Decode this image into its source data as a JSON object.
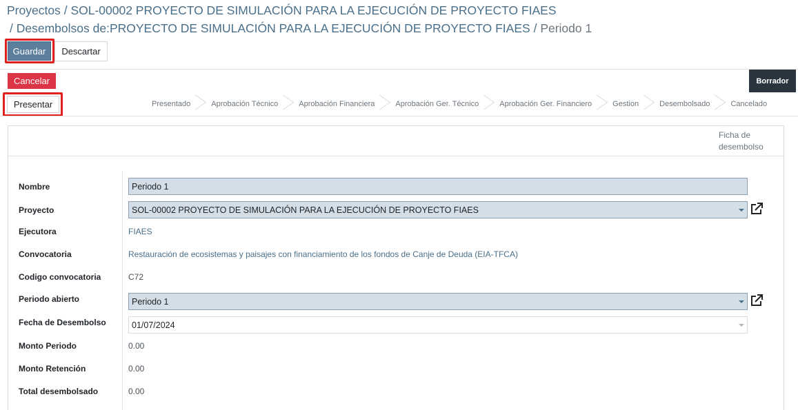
{
  "breadcrumb": {
    "line1": [
      "Proyectos",
      "SOL-00002 PROYECTO DE SIMULACIÓN PARA LA EJECUCIÓN DE PROYECTO FIAES"
    ],
    "line2": [
      "Desembolsos de:PROYECTO DE SIMULACIÓN PARA LA EJECUCIÓN DE PROYECTO FIAES"
    ],
    "current": "Periodo 1",
    "separator": "/"
  },
  "toolbar": {
    "save_label": "Guardar",
    "discard_label": "Descartar"
  },
  "actions": {
    "cancel_label": "Cancelar",
    "present_label": "Presentar"
  },
  "status": {
    "badge": "Borrador",
    "stages": [
      "Presentado",
      "Aprobación Técnico",
      "Aprobación Financiera",
      "Aprobación Ger. Técnico",
      "Aprobación Ger. Financiero",
      "Gestion",
      "Desembolsado",
      "Cancelado"
    ]
  },
  "smart_button": {
    "label_line1": "Ficha de",
    "label_line2": "desembolso"
  },
  "form": {
    "nombre": {
      "label": "Nombre",
      "value": "Periodo 1"
    },
    "proyecto": {
      "label": "Proyecto",
      "value": "SOL-00002 PROYECTO DE SIMULACIÓN PARA LA EJECUCIÓN DE PROYECTO FIAES"
    },
    "ejecutora": {
      "label": "Ejecutora",
      "value": "FIAES"
    },
    "convocatoria": {
      "label": "Convocatoria",
      "value": "Restauración de ecosistemas y paisajes con financiamiento de los fondos de Canje de Deuda (EIA-TFCA)"
    },
    "codigo": {
      "label": "Codigo convocatoria",
      "value": "C72"
    },
    "periodo": {
      "label": "Periodo abierto",
      "value": "Periodo 1"
    },
    "fecha": {
      "label": "Fecha de Desembolso",
      "value": "01/07/2024"
    },
    "monto_periodo": {
      "label": "Monto Periodo",
      "value": "0.00"
    },
    "monto_retencion": {
      "label": "Monto Retención",
      "value": "0.00"
    },
    "total": {
      "label": "Total desembolsado",
      "value": "0.00"
    }
  },
  "colors": {
    "primary": "#5b7f9d",
    "danger": "#dc3545",
    "highlight": "#e01f1f",
    "status_dark": "#2a3540",
    "link": "#4a6f8a"
  },
  "icons": {
    "external_link": "external-link-icon",
    "dropdown": "chevron-down-icon"
  }
}
